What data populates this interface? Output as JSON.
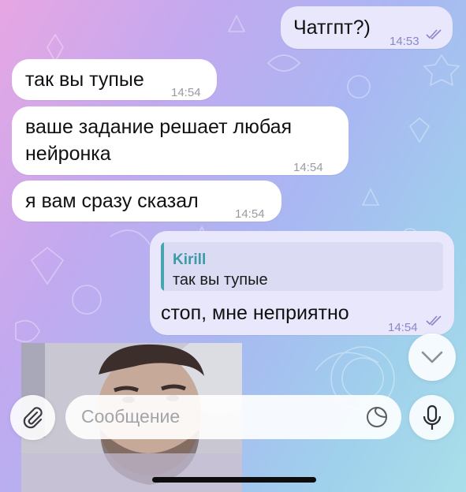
{
  "messages": [
    {
      "id": "m1",
      "direction": "out",
      "text": "Чатгпт?)",
      "time": "14:53",
      "status": "read"
    },
    {
      "id": "m2",
      "direction": "in",
      "text": "так вы тупые",
      "time": "14:54"
    },
    {
      "id": "m3",
      "direction": "in",
      "lines": [
        "ваше задание решает любая",
        "нейронка"
      ],
      "time": "14:54"
    },
    {
      "id": "m4",
      "direction": "in",
      "text": "я вам сразу сказал",
      "time": "14:54"
    },
    {
      "id": "m5",
      "direction": "out",
      "reply_to": {
        "author": "Kirill",
        "text": "так вы тупые"
      },
      "text": "стоп, мне неприятно",
      "time": "14:54",
      "status": "read"
    }
  ],
  "media": {
    "type": "video-message"
  },
  "composer": {
    "placeholder": "Сообщение",
    "attach_icon": "paperclip-icon",
    "sticker_icon": "sticker-icon",
    "mic_icon": "microphone-icon"
  },
  "scroll_down_icon": "chevron-down-icon",
  "colors": {
    "incoming_bubble": "#ffffff",
    "outgoing_bubble": "#e9e7fb",
    "reply_accent": "#45a6b0",
    "time_outgoing": "#8b86c9",
    "time_incoming": "#9a9aa2"
  }
}
